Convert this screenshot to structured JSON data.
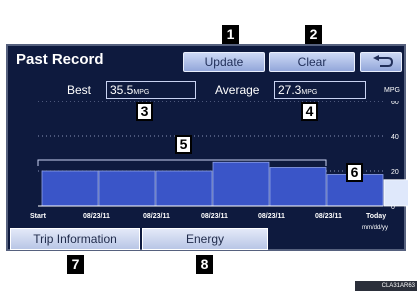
{
  "screen": {
    "title": "Past Record",
    "buttons": {
      "update": "Update",
      "clear": "Clear",
      "back_icon": "return-arrow-icon"
    },
    "best": {
      "label": "Best",
      "value": "35.5",
      "unit": "MPG"
    },
    "average": {
      "label": "Average",
      "value": "27.3",
      "unit": "MPG"
    },
    "tabs": {
      "trip": "Trip Information",
      "energy": "Energy"
    }
  },
  "chart_data": {
    "type": "bar",
    "categories": [
      "Start",
      "08/23/11",
      "08/23/11",
      "08/23/11",
      "08/23/11",
      "08/23/11",
      "Today"
    ],
    "values": [
      20,
      20,
      20,
      25,
      22,
      18,
      15
    ],
    "highlight_index": 6,
    "ylabel": "MPG",
    "yticks": [
      "60",
      "40",
      "20",
      "0"
    ],
    "ylim": [
      0,
      60
    ],
    "xlabel_format": "mm/dd/yy",
    "grid": true
  },
  "callouts": [
    "1",
    "2",
    "3",
    "4",
    "5",
    "6",
    "7",
    "8"
  ],
  "watermark": "CLA31AR63"
}
